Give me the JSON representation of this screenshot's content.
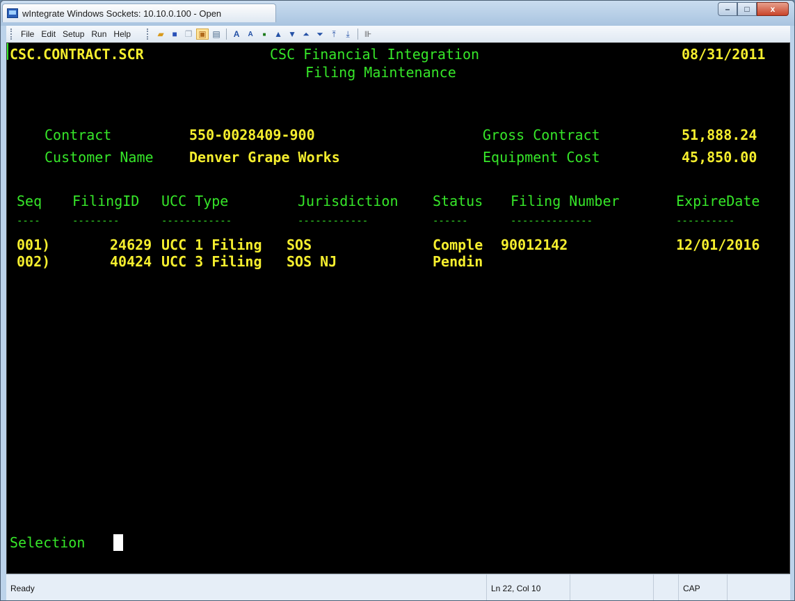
{
  "window": {
    "title": "wIntegrate Windows Sockets: 10.10.0.100 - Open",
    "minimize": "–",
    "maximize": "□",
    "close": "x"
  },
  "menu": [
    "File",
    "Edit",
    "Setup",
    "Run",
    "Help"
  ],
  "toolbar_icons": [
    "open-folder-icon",
    "save-icon",
    "copy-icon",
    "paste-icon",
    "print-icon",
    "font-increase-icon",
    "font-decrease-icon",
    "small-icon",
    "up-arrow-icon",
    "down-arrow-icon",
    "page-up-icon",
    "page-down-icon",
    "top-icon",
    "bottom-icon",
    "connect-icon"
  ],
  "screen": {
    "program": "CSC.CONTRACT.SCR",
    "title1": "CSC Financial Integration",
    "title2": "Filing Maintenance",
    "date": "08/31/2011",
    "contract_label": "Contract",
    "contract_value": "550-0028409-900",
    "customer_label": "Customer Name",
    "customer_value": "Denver Grape Works",
    "gross_label": "Gross Contract",
    "gross_value": "51,888.24",
    "equip_label": "Equipment Cost",
    "equip_value": "45,850.00",
    "headers": {
      "seq": "Seq",
      "filingid": "FilingID",
      "ucctype": "UCC Type",
      "jurisdiction": "Jurisdiction",
      "status": "Status",
      "filingnumber": "Filing Number",
      "expire": "ExpireDate"
    },
    "underlines": {
      "seq": "----",
      "filingid": "--------",
      "ucctype": "------------",
      "jurisdiction": "------------",
      "status": "------",
      "filingnumber": "--------------",
      "expire": "----------"
    },
    "rows": [
      {
        "seq": "001)",
        "filingid": "24629",
        "ucctype": "UCC 1 Filing",
        "jurisdiction": "SOS",
        "status": "Comple",
        "filingnumber": "90012142",
        "expire": "12/01/2016"
      },
      {
        "seq": "002)",
        "filingid": "40424",
        "ucctype": "UCC 3 Filing",
        "jurisdiction": "SOS NJ",
        "status": "Pendin",
        "filingnumber": "",
        "expire": ""
      }
    ],
    "prompt": "Selection"
  },
  "status": {
    "state": "Ready",
    "position": "Ln 22, Col 10",
    "caps": "CAP"
  }
}
